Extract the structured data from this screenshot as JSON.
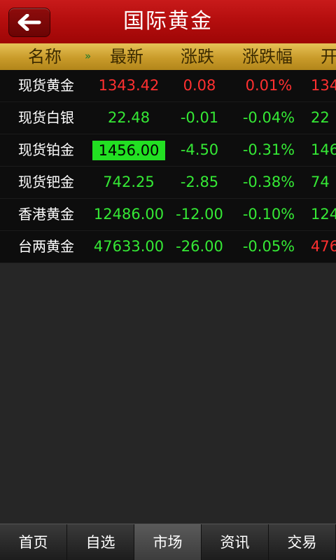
{
  "header": {
    "title": "国际黄金"
  },
  "columns": {
    "name": "名称",
    "scroll_hint": "»",
    "latest": "最新",
    "change": "涨跌",
    "change_pct": "涨跌幅",
    "open": "开"
  },
  "rows": [
    {
      "name": "现货黄金",
      "latest": "1343.42",
      "change": "0.08",
      "change_pct": "0.01%",
      "open": "134",
      "direction": "up"
    },
    {
      "name": "现货白银",
      "latest": "22.48",
      "change": "-0.01",
      "change_pct": "-0.04%",
      "open": "22",
      "direction": "down"
    },
    {
      "name": "现货铂金",
      "latest": "1456.00",
      "change": "-4.50",
      "change_pct": "-0.31%",
      "open": "146",
      "direction": "down"
    },
    {
      "name": "现货钯金",
      "latest": "742.25",
      "change": "-2.85",
      "change_pct": "-0.38%",
      "open": "74",
      "direction": "down"
    },
    {
      "name": "香港黄金",
      "latest": "12486.00",
      "change": "-12.00",
      "change_pct": "-0.10%",
      "open": "124",
      "direction": "down"
    },
    {
      "name": "台两黄金",
      "latest": "47633.00",
      "change": "-26.00",
      "change_pct": "-0.05%",
      "open": "476",
      "direction": "down"
    }
  ],
  "nav": {
    "home": "首页",
    "watchlist": "自选",
    "market": "市场",
    "news": "资讯",
    "trade": "交易"
  },
  "colors": {
    "title_bar": "#b50e0e",
    "header_bar": "#c99b2a",
    "up": "#ff3030",
    "down": "#35e835",
    "highlight": "#22e022"
  },
  "icons": {
    "back": "arrow-left-icon"
  }
}
